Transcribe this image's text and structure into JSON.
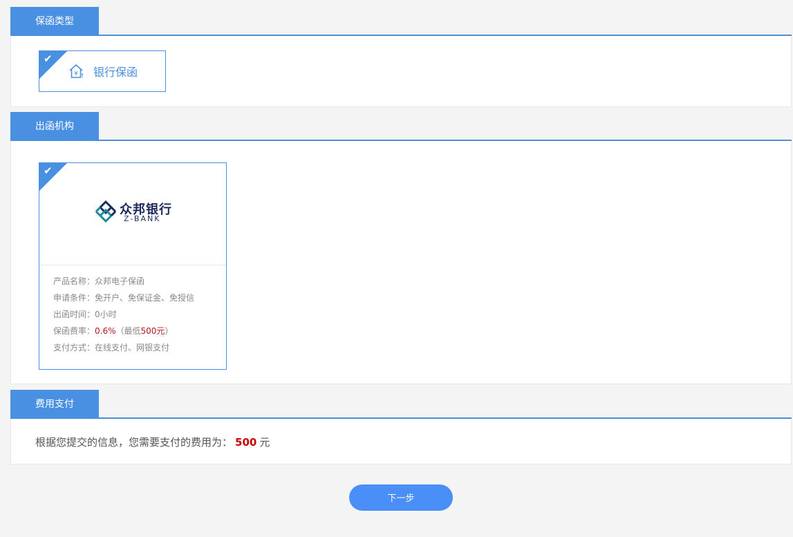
{
  "sections": {
    "guarantee_type": {
      "title": "保函类型",
      "option": {
        "label": "银行保函",
        "selected": true,
        "icon": "bank-house-icon"
      }
    },
    "issuer": {
      "title": "出函机构",
      "bank": {
        "logo_cn": "众邦银行",
        "logo_en": "Z-BANK",
        "selected": true,
        "info": {
          "product_label": "产品名称：",
          "product_value": "众邦电子保函",
          "condition_label": "申请条件：",
          "condition_value": "免开户、免保证金、免授信",
          "time_label": "出函时间：",
          "time_value": "0小时",
          "rate_label": "保函费率：",
          "rate_value": "0.6%",
          "rate_min_prefix": "（最低",
          "rate_min_value": "500元",
          "rate_min_suffix": "）",
          "payment_label": "支付方式：",
          "payment_value": "在线支付、网银支付"
        }
      }
    },
    "payment": {
      "title": "费用支付",
      "text": "根据您提交的信息，您需要支付的费用为：",
      "amount": "500",
      "unit": "元"
    }
  },
  "next_button": "下一步",
  "colors": {
    "accent": "#4a90e2",
    "price_red": "#b8161b",
    "button": "#4a8ef7"
  }
}
